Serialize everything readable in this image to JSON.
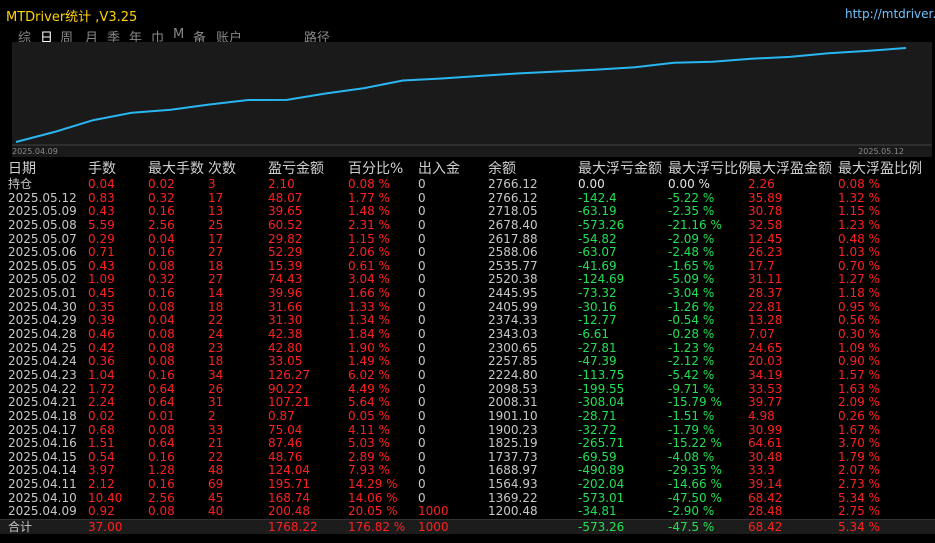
{
  "app": {
    "title": "MTDriver统计 ,V3.25",
    "url": "http://mtdriver.c"
  },
  "tabs": [
    "综",
    "日",
    "周",
    "月",
    "季",
    "年",
    "巾",
    "M",
    "备",
    "账户",
    "路径"
  ],
  "active_tab": 1,
  "chart": {
    "x_start": "2025.04.09",
    "x_end": "2025.05.12",
    "line_color": "#2ab6f0",
    "series": [
      1200.48,
      1369.22,
      1564.93,
      1688.97,
      1737.73,
      1825.19,
      1900.23,
      1901.1,
      2008.31,
      2098.53,
      2224.8,
      2257.85,
      2300.65,
      2343.03,
      2374.33,
      2405.99,
      2445.95,
      2520.38,
      2535.77,
      2588.06,
      2617.88,
      2678.4,
      2718.05,
      2766.12
    ]
  },
  "headers": {
    "date": "日期",
    "lots": "手数",
    "maxlot": "最大手数",
    "count": "次数",
    "pnl": "盈亏金额",
    "pct": "百分比%",
    "io": "出入金",
    "bal": "余额",
    "ddamt": "最大浮亏金额",
    "ddpct": "最大浮亏比例",
    "fpamt": "最大浮盈金额",
    "fppct": "最大浮盈比例"
  },
  "holding": {
    "date": "持仓",
    "lots": "0.04",
    "maxlot": "0.02",
    "count": "3",
    "pnl": "2.10",
    "pct": "0.08 %",
    "io": "0",
    "bal": "2766.12",
    "ddamt": "0.00",
    "ddpct": "0.00 %",
    "fpamt": "2.26",
    "fppct": "0.08 %"
  },
  "rows": [
    {
      "date": "2025.05.12",
      "lots": "0.83",
      "maxlot": "0.32",
      "count": "17",
      "pnl": "48.07",
      "pct": "1.77 %",
      "io": "0",
      "bal": "2766.12",
      "ddamt": "-142.4",
      "ddpct": "-5.22 %",
      "fpamt": "35.89",
      "fppct": "1.32 %"
    },
    {
      "date": "2025.05.09",
      "lots": "0.43",
      "maxlot": "0.16",
      "count": "13",
      "pnl": "39.65",
      "pct": "1.48 %",
      "io": "0",
      "bal": "2718.05",
      "ddamt": "-63.19",
      "ddpct": "-2.35 %",
      "fpamt": "30.78",
      "fppct": "1.15 %"
    },
    {
      "date": "2025.05.08",
      "lots": "5.59",
      "maxlot": "2.56",
      "count": "25",
      "pnl": "60.52",
      "pct": "2.31 %",
      "io": "0",
      "bal": "2678.40",
      "ddamt": "-573.26",
      "ddpct": "-21.16 %",
      "fpamt": "32.58",
      "fppct": "1.23 %"
    },
    {
      "date": "2025.05.07",
      "lots": "0.29",
      "maxlot": "0.04",
      "count": "17",
      "pnl": "29.82",
      "pct": "1.15 %",
      "io": "0",
      "bal": "2617.88",
      "ddamt": "-54.82",
      "ddpct": "-2.09 %",
      "fpamt": "12.45",
      "fppct": "0.48 %"
    },
    {
      "date": "2025.05.06",
      "lots": "0.71",
      "maxlot": "0.16",
      "count": "27",
      "pnl": "52.29",
      "pct": "2.06 %",
      "io": "0",
      "bal": "2588.06",
      "ddamt": "-63.07",
      "ddpct": "-2.48 %",
      "fpamt": "26.23",
      "fppct": "1.03 %"
    },
    {
      "date": "2025.05.05",
      "lots": "0.43",
      "maxlot": "0.08",
      "count": "18",
      "pnl": "15.39",
      "pct": "0.61 %",
      "io": "0",
      "bal": "2535.77",
      "ddamt": "-41.69",
      "ddpct": "-1.65 %",
      "fpamt": "17.7",
      "fppct": "0.70 %"
    },
    {
      "date": "2025.05.02",
      "lots": "1.09",
      "maxlot": "0.32",
      "count": "27",
      "pnl": "74.43",
      "pct": "3.04 %",
      "io": "0",
      "bal": "2520.38",
      "ddamt": "-124.69",
      "ddpct": "-5.09 %",
      "fpamt": "31.11",
      "fppct": "1.27 %"
    },
    {
      "date": "2025.05.01",
      "lots": "0.45",
      "maxlot": "0.16",
      "count": "14",
      "pnl": "39.96",
      "pct": "1.66 %",
      "io": "0",
      "bal": "2445.95",
      "ddamt": "-73.32",
      "ddpct": "-3.04 %",
      "fpamt": "28.37",
      "fppct": "1.18 %"
    },
    {
      "date": "2025.04.30",
      "lots": "0.35",
      "maxlot": "0.08",
      "count": "18",
      "pnl": "31.66",
      "pct": "1.33 %",
      "io": "0",
      "bal": "2405.99",
      "ddamt": "-30.16",
      "ddpct": "-1.26 %",
      "fpamt": "22.81",
      "fppct": "0.95 %"
    },
    {
      "date": "2025.04.29",
      "lots": "0.39",
      "maxlot": "0.04",
      "count": "22",
      "pnl": "31.30",
      "pct": "1.34 %",
      "io": "0",
      "bal": "2374.33",
      "ddamt": "-12.77",
      "ddpct": "-0.54 %",
      "fpamt": "13.28",
      "fppct": "0.56 %"
    },
    {
      "date": "2025.04.28",
      "lots": "0.46",
      "maxlot": "0.08",
      "count": "24",
      "pnl": "42.38",
      "pct": "1.84 %",
      "io": "0",
      "bal": "2343.03",
      "ddamt": "-6.61",
      "ddpct": "-0.28 %",
      "fpamt": "7.07",
      "fppct": "0.30 %"
    },
    {
      "date": "2025.04.25",
      "lots": "0.42",
      "maxlot": "0.08",
      "count": "23",
      "pnl": "42.80",
      "pct": "1.90 %",
      "io": "0",
      "bal": "2300.65",
      "ddamt": "-27.81",
      "ddpct": "-1.23 %",
      "fpamt": "24.65",
      "fppct": "1.09 %"
    },
    {
      "date": "2025.04.24",
      "lots": "0.36",
      "maxlot": "0.08",
      "count": "18",
      "pnl": "33.05",
      "pct": "1.49 %",
      "io": "0",
      "bal": "2257.85",
      "ddamt": "-47.39",
      "ddpct": "-2.12 %",
      "fpamt": "20.03",
      "fppct": "0.90 %"
    },
    {
      "date": "2025.04.23",
      "lots": "1.04",
      "maxlot": "0.16",
      "count": "34",
      "pnl": "126.27",
      "pct": "6.02 %",
      "io": "0",
      "bal": "2224.80",
      "ddamt": "-113.75",
      "ddpct": "-5.42 %",
      "fpamt": "34.19",
      "fppct": "1.57 %"
    },
    {
      "date": "2025.04.22",
      "lots": "1.72",
      "maxlot": "0.64",
      "count": "26",
      "pnl": "90.22",
      "pct": "4.49 %",
      "io": "0",
      "bal": "2098.53",
      "ddamt": "-199.55",
      "ddpct": "-9.71 %",
      "fpamt": "33.53",
      "fppct": "1.63 %"
    },
    {
      "date": "2025.04.21",
      "lots": "2.24",
      "maxlot": "0.64",
      "count": "31",
      "pnl": "107.21",
      "pct": "5.64 %",
      "io": "0",
      "bal": "2008.31",
      "ddamt": "-308.04",
      "ddpct": "-15.79 %",
      "fpamt": "39.77",
      "fppct": "2.09 %"
    },
    {
      "date": "2025.04.18",
      "lots": "0.02",
      "maxlot": "0.01",
      "count": "2",
      "pnl": "0.87",
      "pct": "0.05 %",
      "io": "0",
      "bal": "1901.10",
      "ddamt": "-28.71",
      "ddpct": "-1.51 %",
      "fpamt": "4.98",
      "fppct": "0.26 %"
    },
    {
      "date": "2025.04.17",
      "lots": "0.68",
      "maxlot": "0.08",
      "count": "33",
      "pnl": "75.04",
      "pct": "4.11 %",
      "io": "0",
      "bal": "1900.23",
      "ddamt": "-32.72",
      "ddpct": "-1.79 %",
      "fpamt": "30.99",
      "fppct": "1.67 %"
    },
    {
      "date": "2025.04.16",
      "lots": "1.51",
      "maxlot": "0.64",
      "count": "21",
      "pnl": "87.46",
      "pct": "5.03 %",
      "io": "0",
      "bal": "1825.19",
      "ddamt": "-265.71",
      "ddpct": "-15.22 %",
      "fpamt": "64.61",
      "fppct": "3.70 %"
    },
    {
      "date": "2025.04.15",
      "lots": "0.54",
      "maxlot": "0.16",
      "count": "22",
      "pnl": "48.76",
      "pct": "2.89 %",
      "io": "0",
      "bal": "1737.73",
      "ddamt": "-69.59",
      "ddpct": "-4.08 %",
      "fpamt": "30.48",
      "fppct": "1.79 %"
    },
    {
      "date": "2025.04.14",
      "lots": "3.97",
      "maxlot": "1.28",
      "count": "48",
      "pnl": "124.04",
      "pct": "7.93 %",
      "io": "0",
      "bal": "1688.97",
      "ddamt": "-490.89",
      "ddpct": "-29.35 %",
      "fpamt": "33.3",
      "fppct": "2.07 %"
    },
    {
      "date": "2025.04.11",
      "lots": "2.12",
      "maxlot": "0.16",
      "count": "69",
      "pnl": "195.71",
      "pct": "14.29 %",
      "io": "0",
      "bal": "1564.93",
      "ddamt": "-202.04",
      "ddpct": "-14.66 %",
      "fpamt": "39.14",
      "fppct": "2.73 %"
    },
    {
      "date": "2025.04.10",
      "lots": "10.40",
      "maxlot": "2.56",
      "count": "45",
      "pnl": "168.74",
      "pct": "14.06 %",
      "io": "0",
      "bal": "1369.22",
      "ddamt": "-573.01",
      "ddpct": "-47.50 %",
      "fpamt": "68.42",
      "fppct": "5.34 %"
    },
    {
      "date": "2025.04.09",
      "lots": "0.92",
      "maxlot": "0.08",
      "count": "40",
      "pnl": "200.48",
      "pct": "20.05 %",
      "io": "1000",
      "bal": "1200.48",
      "ddamt": "-34.81",
      "ddpct": "-2.90 %",
      "fpamt": "28.48",
      "fppct": "2.75 %"
    }
  ],
  "total": {
    "date": "合计",
    "lots": "37.00",
    "maxlot": "",
    "count": "",
    "pnl": "1768.22",
    "pct": "176.82 %",
    "io": "1000",
    "bal": "",
    "ddamt": "-573.26",
    "ddpct": "-47.5 %",
    "fpamt": "68.42",
    "fppct": "5.34 %"
  }
}
